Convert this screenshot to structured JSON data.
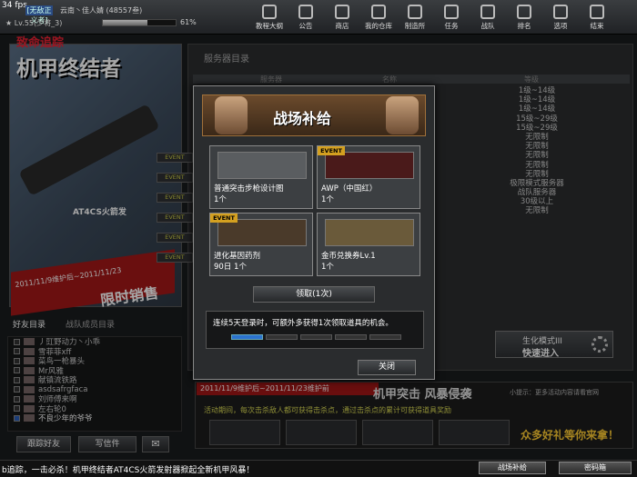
{
  "hud": {
    "fps": "34 fps"
  },
  "profile": {
    "clan_tag": "[无敌正义者]",
    "server_name": "云南丶佳人婧 (48557叁)",
    "level_text": "Lv.55(少将_3)",
    "xp_percent": 61,
    "xp_label": "61%"
  },
  "topnav": [
    {
      "label": "教程大纲",
      "icon": "book-icon"
    },
    {
      "label": "公告",
      "icon": "megaphone-icon"
    },
    {
      "label": "商店",
      "icon": "shop-icon"
    },
    {
      "label": "我的仓库",
      "icon": "storage-icon"
    },
    {
      "label": "制造所",
      "icon": "gun-craft-icon"
    },
    {
      "label": "任务",
      "icon": "task-icon"
    },
    {
      "label": "战队",
      "icon": "shield-icon"
    },
    {
      "label": "排名",
      "icon": "trophy-icon"
    },
    {
      "label": "选项",
      "icon": "gear-icon"
    },
    {
      "label": "结束",
      "icon": "power-icon"
    }
  ],
  "banner": {
    "subtitle": "致命追踪",
    "title": "机甲终结者",
    "gun_name": "AT4CS火箭发",
    "date": "2011/11/9维护后~2011/11/23",
    "limited": "限时销售"
  },
  "friends": {
    "tabs": [
      "好友目录",
      "战队成员目录"
    ],
    "list": [
      "丿豇野动力丶小乖",
      "雪菲菲xff",
      "菜鸟一枪暴头",
      "Mr风雅",
      "献镇流铁路",
      "asdsafrgfaca",
      "刘师傅来啊",
      "左右轮0",
      "不良少年的爷爷"
    ],
    "add_button": "跟踪好友",
    "mail_button": "写信件"
  },
  "server_panel": {
    "title": "服务器目录",
    "headers": [
      "服务器",
      "名称",
      "等级"
    ],
    "levels": [
      "1级~14级",
      "1级~14级",
      "1级~14级",
      "15级~29级",
      "15级~29级",
      "无限制",
      "无限制",
      "无限制",
      "无限制",
      "无限制",
      "极限模式服务器",
      "战队服务器",
      "30级以上",
      "无限制"
    ],
    "event_label": "EVENT",
    "quick_mode": "生化模式III",
    "quick_enter": "快速进入"
  },
  "event_banner": {
    "date": "2011/11/9维护后~2011/11/23维护前",
    "title": "机甲突击 风暴侵袭",
    "tip": "小提示：更多活动内容请看官网",
    "desc": "活动期间，每次击杀敌人都可获得击杀点，通过击杀点的累计可获得道具奖励",
    "gift": "众多好礼等你来拿！"
  },
  "modal": {
    "title": "战场补给",
    "items": [
      {
        "name": "普通突击步枪设计图",
        "qty": "1个",
        "event": false
      },
      {
        "name": "AWP（中国红）",
        "qty": "1个",
        "event": true
      },
      {
        "name": "进化基因药剂",
        "qty": "1个",
        "days": "90日",
        "event": true
      },
      {
        "name": "金币兑换券Lv.1",
        "qty": "1个",
        "event": false
      }
    ],
    "claim_button": "领取(1次)",
    "message": "连续5天登录时，可额外多获得1次领取道具的机会。",
    "progress_done": 1,
    "progress_total": 5,
    "close_button": "关闭",
    "event_badge": "EVENT"
  },
  "ticker": {
    "text": "b追踪，一击必杀！机甲终结者AT4CS火箭发射器掀起全新机甲风暴！",
    "supply_button": "战场补给",
    "code_button": "密码箱"
  }
}
